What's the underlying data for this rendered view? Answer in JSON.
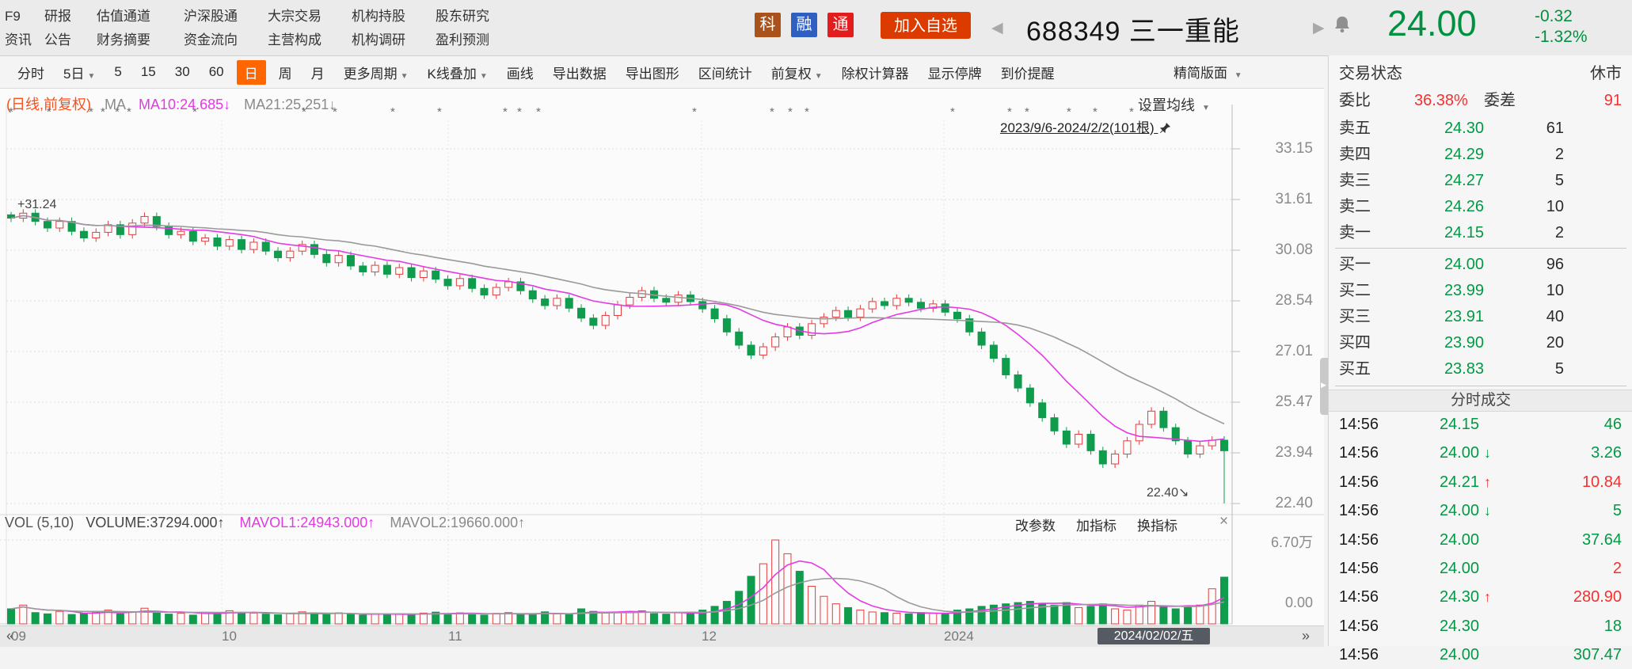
{
  "header": {
    "menu_columns": [
      [
        "F9",
        "资讯"
      ],
      [
        "研报",
        "公告"
      ],
      [
        "估值通道",
        "财务摘要"
      ],
      [
        "沪深股通",
        "资金流向"
      ],
      [
        "大宗交易",
        "主营构成"
      ],
      [
        "机构持股",
        "机构调研"
      ],
      [
        "股东研究",
        "盈利预测"
      ]
    ],
    "badges": [
      {
        "text": "科",
        "bg": "#a9521c"
      },
      {
        "text": "融",
        "bg": "#2f5fc0"
      },
      {
        "text": "通",
        "bg": "#e11d1d"
      }
    ],
    "add_watchlist": "加入自选",
    "stock_code": "688349",
    "stock_name": "三一重能",
    "price": "24.00",
    "change": "-0.32",
    "change_pct": "-1.32%",
    "price_color": "#009140"
  },
  "toolbar": {
    "items": [
      {
        "label": "分时"
      },
      {
        "label": "5日",
        "caret": true
      },
      {
        "label": "5"
      },
      {
        "label": "15"
      },
      {
        "label": "30"
      },
      {
        "label": "60"
      },
      {
        "label": "日",
        "selected": true
      },
      {
        "label": "周"
      },
      {
        "label": "月"
      },
      {
        "label": "更多周期",
        "caret": true
      },
      {
        "label": "K线叠加",
        "caret": true
      },
      {
        "label": "画线"
      },
      {
        "label": "导出数据"
      },
      {
        "label": "导出图形"
      },
      {
        "label": "区间统计"
      },
      {
        "label": "前复权",
        "caret": true
      },
      {
        "label": "除权计算器"
      },
      {
        "label": "显示停牌"
      },
      {
        "label": "到价提醒"
      }
    ],
    "panel_toggle": "精简版面"
  },
  "chart": {
    "period_label": "(日线,前复权)",
    "ma_label": "MA",
    "ma10_label": "MA10:24.685↓",
    "ma21_label": "MA21:25.251↓",
    "ma_settings": "设置均线",
    "range_label": "2023/9/6-2024/2/2(101根)",
    "high_marker": "+31.24",
    "low_marker": "22.40↘",
    "y_ticks": [
      "33.15",
      "31.61",
      "30.08",
      "28.54",
      "27.01",
      "25.47",
      "23.94",
      "22.40"
    ],
    "vol_header": {
      "indicator": "VOL (5,10)",
      "volume": "VOLUME:37294.000↑",
      "mavol1": "MAVOL1:24943.000↑",
      "mavol2": "MAVOL2:19660.000↑"
    },
    "vol_buttons": [
      "改参数",
      "加指标",
      "换指标"
    ],
    "vol_close": "×",
    "vol_ticks": [
      "6.70万",
      "0.00"
    ]
  },
  "chart_data": {
    "type": "candlestick",
    "title": "688349 三一重能 日K线 前复权",
    "date_range": "2023/9/6-2024/2/2",
    "bars": 101,
    "y_axis": [
      33.15,
      31.61,
      30.08,
      28.54,
      27.01,
      25.47,
      23.94,
      22.4
    ],
    "volume_axis_max": 67000,
    "first_open": 31.15,
    "range_high": 31.24,
    "range_low": 22.4,
    "closes": [
      31.05,
      31.2,
      30.95,
      30.75,
      30.95,
      30.65,
      30.45,
      30.62,
      30.85,
      30.55,
      30.9,
      31.1,
      30.8,
      30.55,
      30.65,
      30.35,
      30.45,
      30.2,
      30.4,
      30.1,
      30.32,
      30.05,
      29.85,
      30.05,
      30.25,
      29.95,
      29.7,
      29.92,
      29.6,
      29.42,
      29.62,
      29.35,
      29.55,
      29.25,
      29.45,
      29.2,
      29.0,
      29.22,
      28.92,
      28.72,
      28.95,
      29.12,
      28.85,
      28.6,
      28.4,
      28.62,
      28.32,
      28.02,
      27.8,
      28.1,
      28.42,
      28.65,
      28.85,
      28.62,
      28.5,
      28.72,
      28.52,
      28.3,
      28.0,
      27.6,
      27.2,
      26.9,
      27.15,
      27.45,
      27.75,
      27.5,
      27.85,
      28.05,
      28.25,
      28.05,
      28.3,
      28.52,
      28.4,
      28.62,
      28.5,
      28.32,
      28.45,
      28.2,
      28.0,
      27.6,
      27.2,
      26.8,
      26.3,
      25.9,
      25.45,
      25.0,
      24.6,
      24.2,
      24.5,
      24.0,
      23.6,
      23.9,
      24.3,
      24.8,
      25.2,
      24.7,
      24.3,
      23.9,
      24.15,
      24.32,
      24.0
    ],
    "volumes": [
      12000,
      15000,
      9000,
      8000,
      10000,
      7500,
      8200,
      9500,
      11000,
      8000,
      9800,
      12500,
      9000,
      7800,
      8500,
      7000,
      9200,
      8800,
      10500,
      9000,
      8600,
      7800,
      7200,
      8400,
      9600,
      8100,
      7400,
      8800,
      7600,
      7000,
      8200,
      7500,
      8000,
      7200,
      8600,
      9400,
      8200,
      8800,
      7600,
      7000,
      8400,
      9000,
      7800,
      7200,
      9600,
      8000,
      7400,
      12000,
      10000,
      8600,
      9200,
      9800,
      10400,
      8200,
      7800,
      8800,
      8000,
      11000,
      14000,
      18000,
      26000,
      38000,
      48000,
      67000,
      56000,
      42000,
      30000,
      22000,
      16000,
      13000,
      11000,
      9500,
      9000,
      8500,
      8000,
      9000,
      8500,
      8000,
      11000,
      12000,
      14000,
      15000,
      16000,
      17000,
      18000,
      16000,
      15000,
      17000,
      13000,
      14000,
      16000,
      12000,
      11000,
      15000,
      18000,
      14000,
      12000,
      13000,
      15000,
      28000,
      37294
    ],
    "ma_periods": [
      10,
      21
    ],
    "mavol_periods": [
      5,
      10
    ],
    "event_marker_xs": [
      11,
      59,
      112,
      127,
      145,
      160,
      243,
      381,
      420,
      493,
      552,
      635,
      653,
      677,
      874,
      972,
      995,
      1016,
      1200,
      1272,
      1294,
      1347,
      1380,
      1426,
      1445,
      1482
    ],
    "month_grid_xs": [
      280,
      566,
      886,
      1192
    ],
    "colors": {
      "up": "#e23e3e",
      "down": "#0f9c4d",
      "ma10": "#e33ae3",
      "ma21": "#9a9a9a"
    }
  },
  "xaxis": {
    "nav_left": "«",
    "nav_right": "»",
    "labels": [
      {
        "text": "09",
        "x": 14
      },
      {
        "text": "10",
        "x": 280
      },
      {
        "text": "11",
        "x": 566
      },
      {
        "text": "12",
        "x": 886
      },
      {
        "text": "2024",
        "x": 1192
      }
    ],
    "current": {
      "text": "2024/02/02/五",
      "x": 1386,
      "w": 142
    }
  },
  "panel": {
    "trade_status_label": "交易状态",
    "trade_status": "休市",
    "weibi_label": "委比",
    "weibi": "36.38%",
    "weicha_label": "委差",
    "weicha": "91",
    "asks": [
      {
        "label": "卖五",
        "price": "24.30",
        "qty": "61"
      },
      {
        "label": "卖四",
        "price": "24.29",
        "qty": "2"
      },
      {
        "label": "卖三",
        "price": "24.27",
        "qty": "5"
      },
      {
        "label": "卖二",
        "price": "24.26",
        "qty": "10"
      },
      {
        "label": "卖一",
        "price": "24.15",
        "qty": "2"
      }
    ],
    "bids": [
      {
        "label": "买一",
        "price": "24.00",
        "qty": "96"
      },
      {
        "label": "买二",
        "price": "23.99",
        "qty": "10"
      },
      {
        "label": "买三",
        "price": "23.91",
        "qty": "40"
      },
      {
        "label": "买四",
        "price": "23.90",
        "qty": "20"
      },
      {
        "label": "买五",
        "price": "23.83",
        "qty": "5"
      }
    ],
    "ts_title": "分时成交",
    "ticks": [
      {
        "time": "14:56",
        "price": "24.15",
        "dir": "",
        "qty": "46",
        "qc": "g"
      },
      {
        "time": "14:56",
        "price": "24.00",
        "dir": "down",
        "qty": "3.26",
        "qc": "g"
      },
      {
        "time": "14:56",
        "price": "24.21",
        "dir": "up",
        "qty": "10.84",
        "qc": "r"
      },
      {
        "time": "14:56",
        "price": "24.00",
        "dir": "down",
        "qty": "5",
        "qc": "g"
      },
      {
        "time": "14:56",
        "price": "24.00",
        "dir": "",
        "qty": "37.64",
        "qc": "g"
      },
      {
        "time": "14:56",
        "price": "24.00",
        "dir": "",
        "qty": "2",
        "qc": "r"
      },
      {
        "time": "14:56",
        "price": "24.30",
        "dir": "up",
        "qty": "280.90",
        "qc": "r"
      },
      {
        "time": "14:56",
        "price": "24.30",
        "dir": "",
        "qty": "18",
        "qc": "g"
      },
      {
        "time": "14:56",
        "price": "24.00",
        "dir": "",
        "qty": "307.47",
        "qc": "g"
      }
    ]
  }
}
